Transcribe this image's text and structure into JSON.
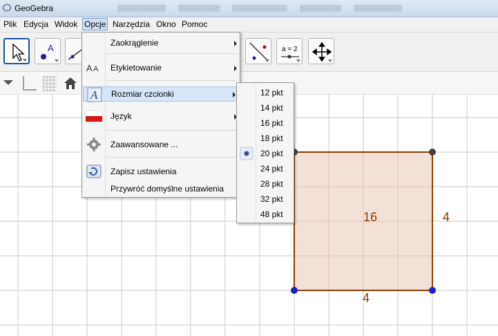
{
  "window": {
    "title": "GeoGebra"
  },
  "menubar": {
    "items": [
      {
        "label": "Plik"
      },
      {
        "label": "Edycja"
      },
      {
        "label": "Widok"
      },
      {
        "label": "Opcje"
      },
      {
        "label": "Narzędzia"
      },
      {
        "label": "Okno"
      },
      {
        "label": "Pomoc"
      }
    ]
  },
  "toolbar": {
    "tools": [
      {
        "icon": "move-arrow-icon"
      },
      {
        "icon": "point-icon",
        "label": "A"
      },
      {
        "icon": "line-icon"
      },
      {
        "icon": "perpendicular-line-icon"
      },
      {
        "icon": "slider-icon",
        "label": "a = 2"
      },
      {
        "icon": "move-graphics-view-icon"
      }
    ]
  },
  "options_menu": {
    "items": [
      {
        "label": "Zaokrąglenie",
        "icon": "none",
        "has_submenu": true
      },
      {
        "label": "Etykietowanie",
        "icon": "label-aa-icon",
        "has_submenu": true
      },
      {
        "label": "Rozmiar czcionki",
        "icon": "font-size-icon",
        "has_submenu": true,
        "highlighted": true
      },
      {
        "label": "Język",
        "icon": "flag-icon",
        "has_submenu": true
      },
      {
        "label": "Zaawansowane ...",
        "icon": "gear-icon",
        "has_submenu": false
      },
      {
        "label": "Zapisz ustawienia",
        "icon": "save-settings-icon",
        "has_submenu": false
      },
      {
        "label": "Przywróć domyślne ustawienia",
        "icon": "none",
        "has_submenu": false
      }
    ]
  },
  "font_size_submenu": {
    "selected": "20 pkt",
    "items": [
      {
        "label": "12 pkt"
      },
      {
        "label": "14 pkt"
      },
      {
        "label": "16 pkt"
      },
      {
        "label": "18 pkt"
      },
      {
        "label": "20 pkt"
      },
      {
        "label": "24 pkt"
      },
      {
        "label": "28 pkt"
      },
      {
        "label": "32 pkt"
      },
      {
        "label": "48 pkt"
      }
    ]
  },
  "graphics": {
    "square_area_label": "16",
    "side_right_label": "4",
    "side_bottom_label": "4",
    "colors": {
      "polygon_fill": "#f3e1d8",
      "polygon_edge": "#8b3a00",
      "free_point": "#1f1fcc",
      "dependent_point": "#404040",
      "grid": "#c8c8c8"
    }
  }
}
